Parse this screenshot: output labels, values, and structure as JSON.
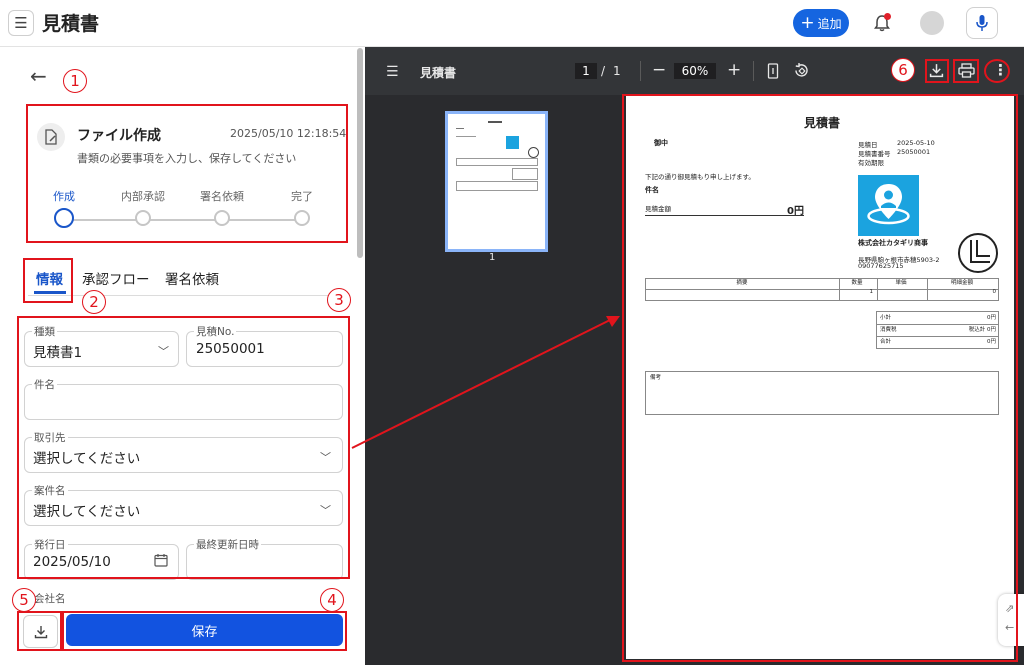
{
  "header": {
    "title": "見積書",
    "add_label": "追加"
  },
  "stepper": {
    "title": "ファイル作成",
    "timestamp": "2025/05/10 12:18:54",
    "description": "書類の必要事項を入力し、保存してください",
    "steps": [
      "作成",
      "内部承認",
      "署名依頼",
      "完了"
    ],
    "current_step": 1
  },
  "tabs": [
    "情報",
    "承認フロー",
    "署名依頼"
  ],
  "form": {
    "type_label": "種類",
    "type_value": "見積書1",
    "quote_no_label": "見積No.",
    "quote_no_value": "25050001",
    "subject_label": "件名",
    "subject_value": "",
    "client_label": "取引先",
    "client_value": "選択してください",
    "project_label": "案件名",
    "project_value": "選択してください",
    "issue_date_label": "発行日",
    "issue_date_value": "2025/05/10",
    "updated_label": "最終更新日時",
    "updated_value": "",
    "company_label": "会社名"
  },
  "actions": {
    "save_label": "保存"
  },
  "annotations": [
    "1",
    "2",
    "3",
    "4",
    "5",
    "6"
  ],
  "viewer": {
    "title": "見積書",
    "page_current": "1",
    "page_sep": "/",
    "page_total": "1",
    "zoom": "60%",
    "thumb_label": "1"
  },
  "document": {
    "title": "見積書",
    "to": "御中",
    "date_label": "見積日",
    "date_value": "2025-05-10",
    "no_label": "見積書番号",
    "no_value": "25050001",
    "valid_label": "有効期限",
    "intro": "下記の通り御見積もり申し上げます。",
    "subject_label": "件名",
    "amount_label": "見積金額",
    "amount_value": "0円",
    "company": "株式会社カタギリ商事",
    "address": "長野県駒ヶ根市赤穂5903-2",
    "phone": "09077625715",
    "columns": [
      "摘要",
      "数量",
      "単価",
      "明細金額"
    ],
    "row": [
      "",
      "1",
      "",
      "0"
    ],
    "subtotal_label": "小計",
    "subtotal_value": "0円",
    "tax_label": "消費税",
    "tax_value": "税込計 0円",
    "total_label": "合計",
    "total_value": "0円",
    "notes_label": "備考"
  },
  "colors": {
    "accent": "#1a56c9",
    "primary_button": "#1253e0",
    "annotation": "#e1141c",
    "viewer_bg": "#2a2b2e"
  }
}
